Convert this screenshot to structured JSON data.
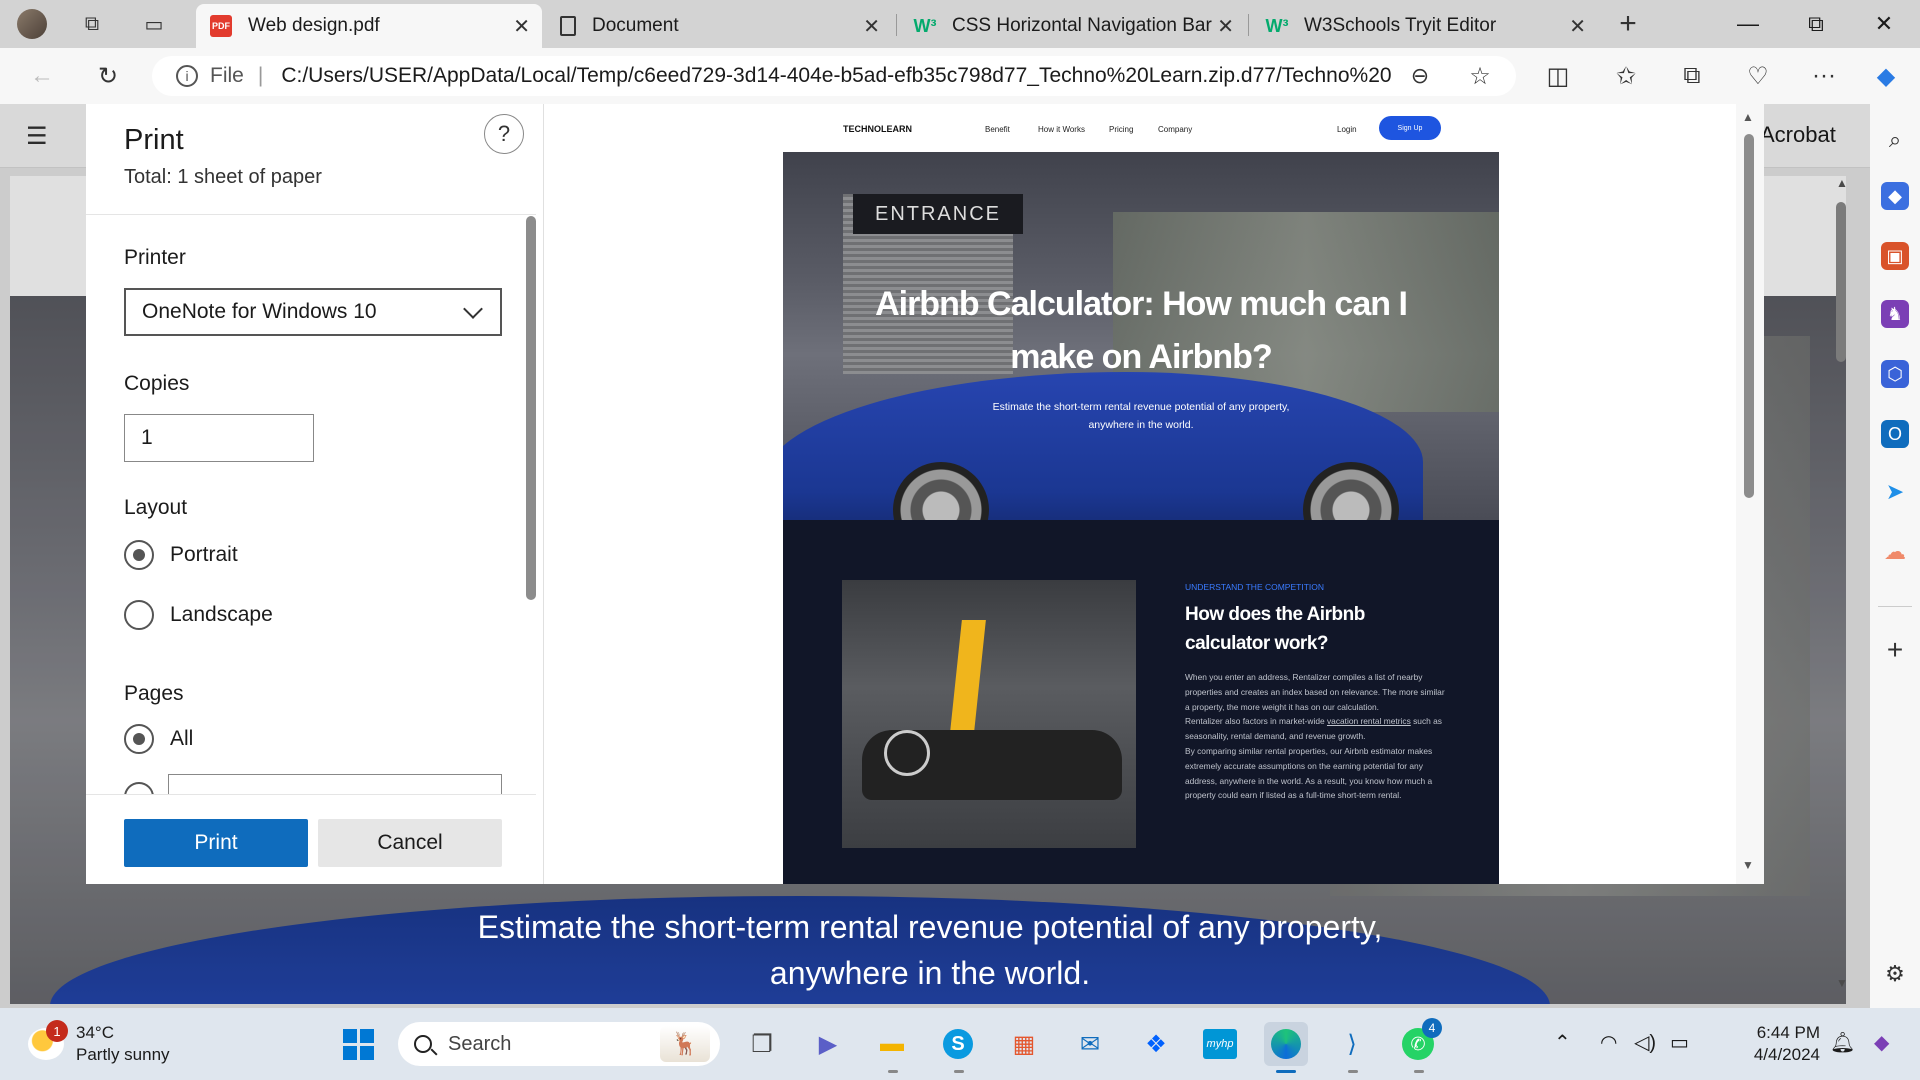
{
  "tabs": [
    {
      "label": "Web design.pdf",
      "type": "pdf",
      "active": true
    },
    {
      "label": "Document",
      "type": "doc",
      "active": false
    },
    {
      "label": "CSS Horizontal Navigation Bar",
      "type": "w3",
      "active": false
    },
    {
      "label": "W3Schools Tryit Editor",
      "type": "w3",
      "active": false
    }
  ],
  "address": {
    "file_label": "File",
    "url": "C:/Users/USER/AppData/Local/Temp/c6eed729-3d14-404e-b5ad-efb35c798d77_Techno%20Learn.zip.d77/Techno%20..."
  },
  "pdf_viewer": {
    "acrobat_label": "Acrobat",
    "bg_subtitle": "Estimate the short-term rental revenue potential of any property, anywhere in the world."
  },
  "print": {
    "title": "Print",
    "total": "Total: 1 sheet of paper",
    "help": "?",
    "printer_label": "Printer",
    "printer_value": "OneNote for Windows 10",
    "copies_label": "Copies",
    "copies_value": "1",
    "layout_label": "Layout",
    "layout_options": [
      "Portrait",
      "Landscape"
    ],
    "pages_label": "Pages",
    "pages_options": [
      "All"
    ],
    "print_button": "Print",
    "cancel_button": "Cancel"
  },
  "preview": {
    "logo": "TECHNOLEARN",
    "nav_links": [
      "Benefit",
      "How it Works",
      "Pricing",
      "Company"
    ],
    "login": "Login",
    "signup": "Sign Up",
    "entrance": "ENTRANCE",
    "hero_title": "Airbnb Calculator: How much can I make on Airbnb?",
    "hero_sub": "Estimate the short-term rental revenue potential of any property, anywhere in the world.",
    "kicker": "UNDERSTAND THE COMPETITION",
    "section_title": "How does the Airbnb calculator work?",
    "para1": "When you enter an address, Rentalizer compiles a list of nearby properties and creates an index based on relevance. The more similar a property, the more weight it has on our calculation.",
    "para2_pre": "Rentalizer also factors in market-wide ",
    "para2_link": "vacation rental metrics",
    "para2_post": " such as seasonality, rental demand, and revenue growth.",
    "para3": "By comparing similar rental properties, our Airbnb estimator makes extremely accurate assumptions on the earning potential for any address, anywhere in the world. As a result, you know how much a property could earn if listed as a full-time short-term rental."
  },
  "taskbar": {
    "weather_badge": "1",
    "temperature": "34°C",
    "condition": "Partly sunny",
    "search_placeholder": "Search",
    "whatsapp_badge": "4",
    "time": "6:44 PM",
    "date": "4/4/2024"
  }
}
